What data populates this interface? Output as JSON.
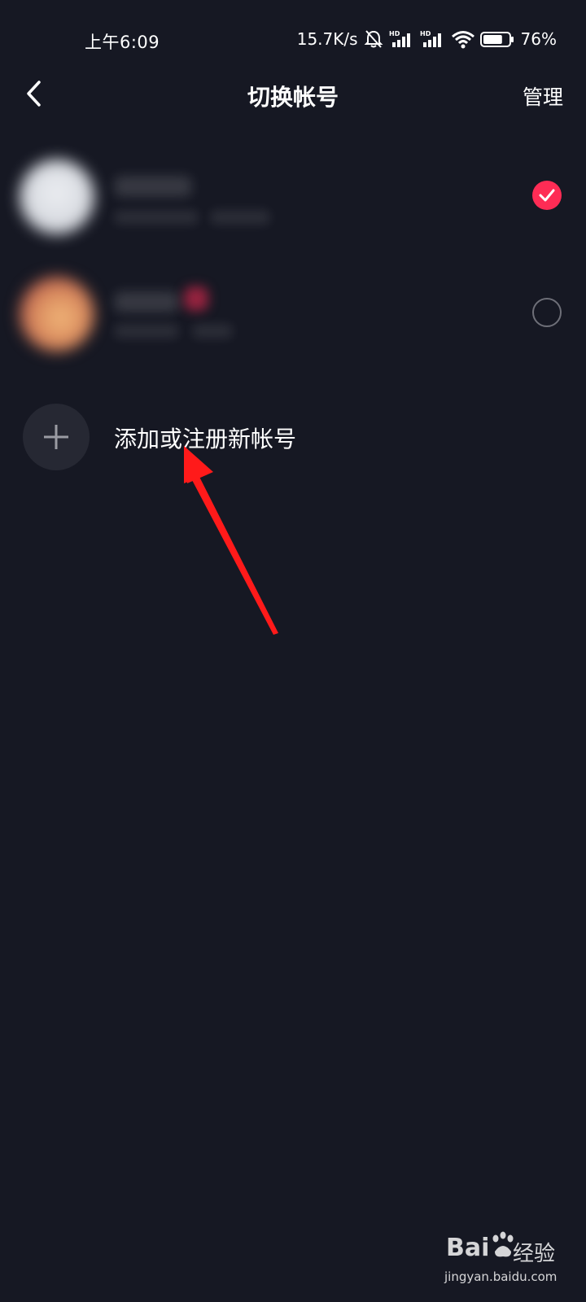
{
  "status_bar": {
    "time": "上午6:09",
    "network_speed": "15.7K/s",
    "hd1": "HD",
    "hd2": "HD",
    "battery_percent": "76%",
    "battery_level": 0.76,
    "icons": [
      "mute-bell-icon",
      "signal-icon",
      "signal-icon",
      "wifi-icon",
      "battery-icon"
    ]
  },
  "navbar": {
    "title": "切换帐号",
    "manage_label": "管理",
    "back_icon": "chevron-left-icon"
  },
  "accounts": [
    {
      "selected": true
    },
    {
      "selected": false
    }
  ],
  "add_account": {
    "label": "添加或注册新帐号",
    "icon": "plus-icon"
  },
  "watermark": {
    "logo_text": "Bai",
    "logo_cn": "经验",
    "url": "jingyan.baidu.com"
  },
  "colors": {
    "background": "#161823",
    "accent": "#fe2c55",
    "annotation": "#ff1a1a"
  }
}
